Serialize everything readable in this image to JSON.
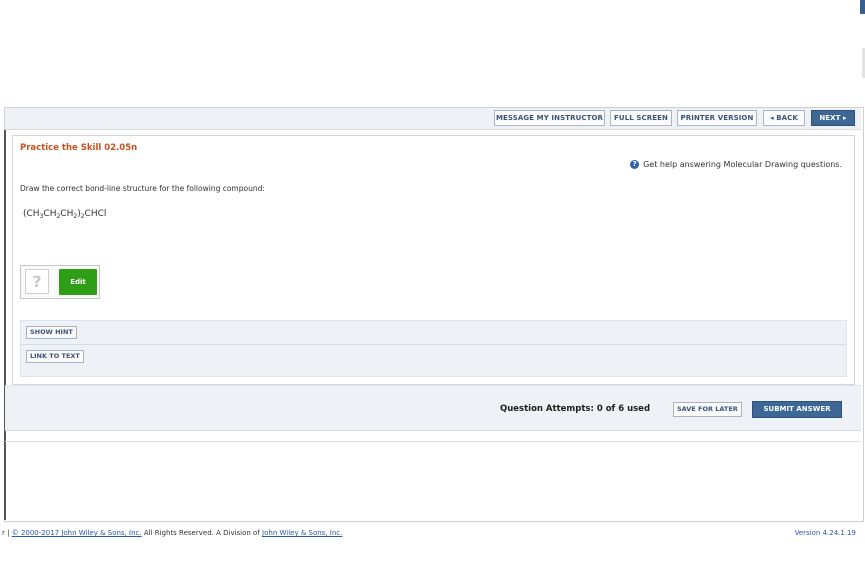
{
  "toolbar": {
    "message_instructor": "MESSAGE MY INSTRUCTOR",
    "full_screen": "FULL SCREEN",
    "printer_version": "PRINTER VERSION",
    "back": "◂ BACK",
    "next": "NEXT ▸"
  },
  "question": {
    "title": "Practice the Skill 02.05n",
    "help_icon": "question-circle-icon",
    "help_text": "Get help answering Molecular Drawing questions.",
    "instruction": "Draw the correct bond-line structure for the following compound:",
    "formula_parts": [
      "(CH",
      "3",
      "CH",
      "2",
      "CH",
      "2",
      ")",
      "2",
      "CHCl"
    ],
    "editor_placeholder": "?",
    "edit_label": "Edit"
  },
  "hints": {
    "show_hint": "SHOW HINT",
    "link_to_text": "LINK TO TEXT"
  },
  "actions": {
    "attempts": "Question Attempts: 0 of 6 used",
    "save_for_later": "SAVE FOR LATER",
    "submit_answer": "SUBMIT ANSWER"
  },
  "footer": {
    "left_mark": "r",
    "separator": "|",
    "copyright_link": "© 2000-2017 John Wiley & Sons, Inc.",
    "rights": " All Rights Reserved. A Division of ",
    "company_link": "John Wiley & Sons, Inc.",
    "version": "Version 4.24.1.19"
  },
  "colors": {
    "accent": "#3d6794",
    "title": "#c8501e",
    "edit_button": "#2e9e16"
  }
}
